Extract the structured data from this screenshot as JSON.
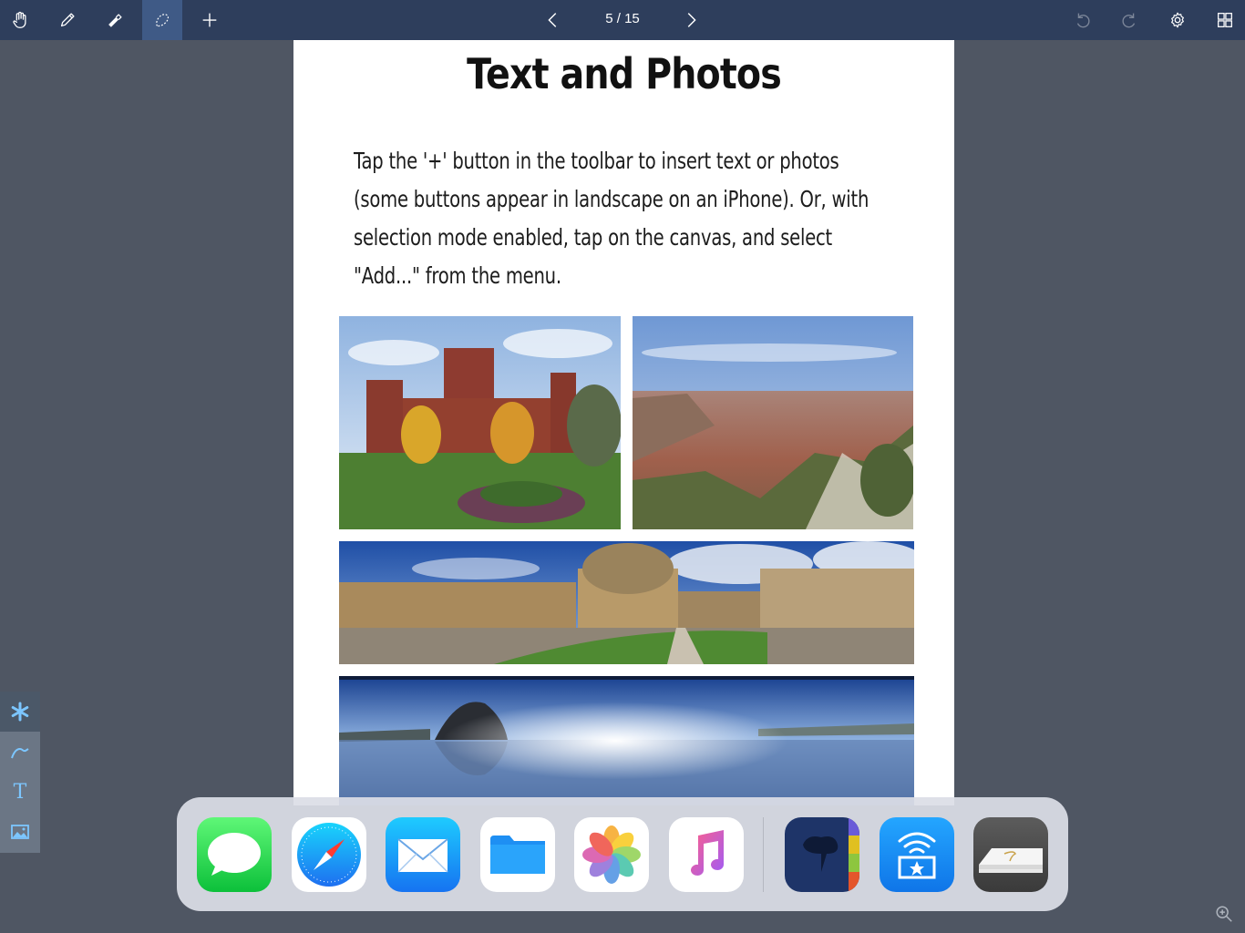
{
  "toolbar": {
    "page_indicator": "5 / 15",
    "tools": [
      {
        "name": "hand-tool",
        "active": false
      },
      {
        "name": "pen-tool",
        "active": false
      },
      {
        "name": "eraser-tool",
        "active": false
      },
      {
        "name": "lasso-tool",
        "active": true
      },
      {
        "name": "add",
        "active": false
      }
    ],
    "accent_color": "#2e3e5c",
    "active_color": "#3f5a86"
  },
  "page": {
    "title": "Text and Photos",
    "body_lines": [
      "Tap the '+' button in the toolbar to insert text or photos",
      "(some buttons appear in landscape on an iPhone). Or, with",
      "selection mode enabled, tap on the canvas, and select",
      "\"Add...\" from the menu."
    ],
    "photos": [
      "castle-photo",
      "canyon-photo",
      "college-panorama-photo",
      "beach-panorama-photo"
    ]
  },
  "palette": {
    "items": [
      "asterisk-icon",
      "curve-icon",
      "text-icon",
      "image-icon"
    ],
    "text_glyph": "T",
    "accent": "#7cc6ff"
  },
  "dock": {
    "apps": [
      "messages",
      "safari",
      "mail",
      "files",
      "photos",
      "music",
      "notes-app",
      "wifi-share",
      "paper-stack"
    ]
  }
}
